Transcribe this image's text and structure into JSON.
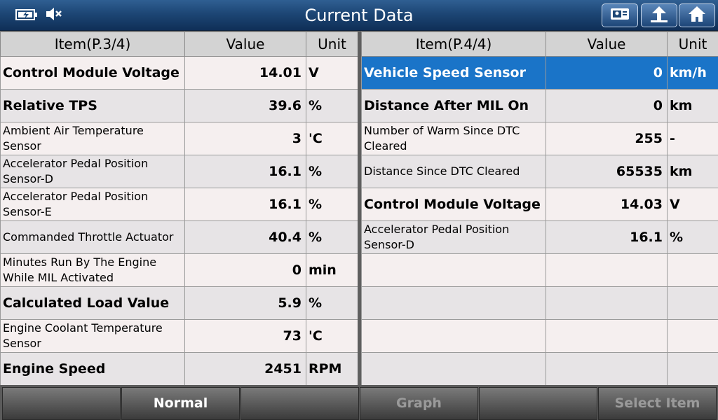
{
  "header": {
    "title": "Current Data"
  },
  "left_table": {
    "headers": {
      "item": "Item(P.3/4)",
      "value": "Value",
      "unit": "Unit"
    },
    "rows": [
      {
        "item": "Control Module Voltage",
        "value": "14.01",
        "unit": "V"
      },
      {
        "item": "Relative TPS",
        "value": "39.6",
        "unit": "%"
      },
      {
        "item": "Ambient Air Temperature Sensor",
        "value": "3",
        "unit": "'C"
      },
      {
        "item": "Accelerator Pedal Position Sensor-D",
        "value": "16.1",
        "unit": "%"
      },
      {
        "item": "Accelerator Pedal Position Sensor-E",
        "value": "16.1",
        "unit": "%"
      },
      {
        "item": "Commanded Throttle Actuator",
        "value": "40.4",
        "unit": "%"
      },
      {
        "item": "Minutes Run By The Engine While MIL Activated",
        "value": "0",
        "unit": "min"
      },
      {
        "item": "Calculated Load Value",
        "value": "5.9",
        "unit": "%"
      },
      {
        "item": "Engine Coolant Temperature Sensor",
        "value": "73",
        "unit": "'C"
      },
      {
        "item": "Engine Speed",
        "value": "2451",
        "unit": "RPM"
      }
    ]
  },
  "right_table": {
    "headers": {
      "item": "Item(P.4/4)",
      "value": "Value",
      "unit": "Unit"
    },
    "rows": [
      {
        "item": "Vehicle Speed Sensor",
        "value": "0",
        "unit": "km/h"
      },
      {
        "item": "Distance After MIL On",
        "value": "0",
        "unit": "km"
      },
      {
        "item": "Number of Warm Since DTC Cleared",
        "value": "255",
        "unit": "-"
      },
      {
        "item": "Distance Since DTC Cleared",
        "value": "65535",
        "unit": "km"
      },
      {
        "item": "Control Module Voltage",
        "value": "14.03",
        "unit": "V"
      },
      {
        "item": "Accelerator Pedal Position Sensor-D",
        "value": "16.1",
        "unit": "%"
      },
      {
        "item": "",
        "value": "",
        "unit": ""
      },
      {
        "item": "",
        "value": "",
        "unit": ""
      },
      {
        "item": "",
        "value": "",
        "unit": ""
      },
      {
        "item": "",
        "value": "",
        "unit": ""
      }
    ]
  },
  "toolbar": {
    "buttons": [
      {
        "label": ""
      },
      {
        "label": "Normal"
      },
      {
        "label": ""
      },
      {
        "label": "Graph"
      },
      {
        "label": ""
      },
      {
        "label": "Select Item"
      }
    ]
  },
  "icons": {
    "battery": "battery-icon",
    "mute": "speaker-mute-icon",
    "report": "report-icon",
    "back": "back-arrow-icon",
    "home": "home-icon"
  },
  "colors": {
    "selected_row": "#1a74c8",
    "title_bar": "#1d4675"
  }
}
